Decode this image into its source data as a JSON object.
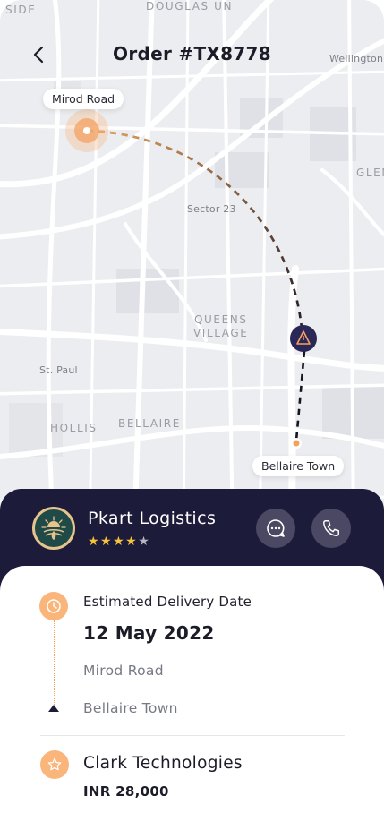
{
  "header": {
    "title": "Order #TX8778"
  },
  "map": {
    "labels": {
      "top_left_cut": "SIDE",
      "top_center_cut": "DOUGLAS UN",
      "wellington": "Wellington",
      "glen": "GLEN",
      "sector": "Sector 23",
      "queens": "QUEENS",
      "village": "VILLAGE",
      "st_paul": "St. Paul",
      "hollis": "HOLLIS",
      "bellaire": "BELLAIRE"
    },
    "origin": "Mirod Road",
    "destination": "Bellaire Town",
    "accent_color": "#f2a25a",
    "courier_color": "#2b2858"
  },
  "courier": {
    "name": "Pkart Logistics",
    "rating_filled": 4,
    "rating_max": 5,
    "stars_on": "★★★★",
    "stars_off": "★"
  },
  "details": {
    "estimated_label": "Estimated Delivery Date",
    "estimated_date": "12 May 2022",
    "from": "Mirod Road",
    "to": "Bellaire Town",
    "client_name": "Clark Technologies",
    "amount": "INR 28,000"
  }
}
